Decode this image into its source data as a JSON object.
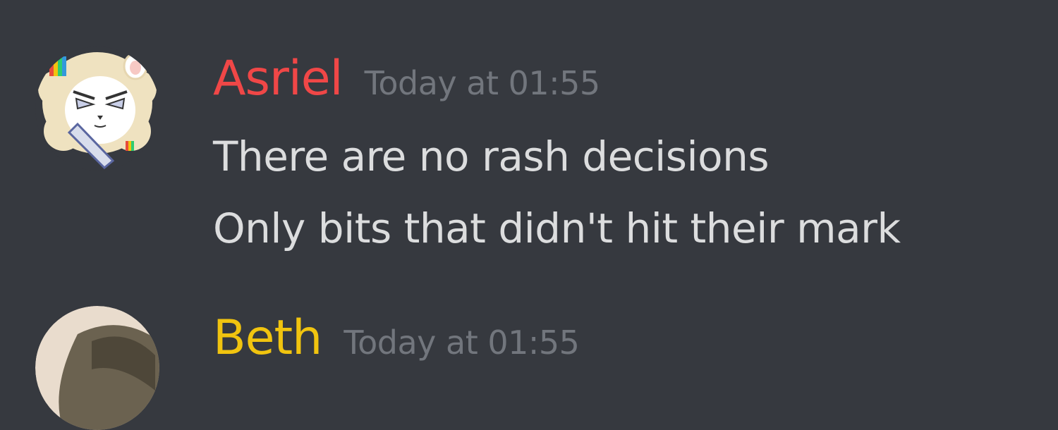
{
  "messages": [
    {
      "username": "Asriel",
      "username_color": "#f04747",
      "timestamp": "Today at 01:55",
      "lines": [
        "There are no rash decisions",
        "Only bits that didn't hit their mark"
      ],
      "avatar_icon": "goat-character-avatar"
    },
    {
      "username": "Beth",
      "username_color": "#f1c40f",
      "timestamp": "Today at 01:55",
      "lines": [],
      "avatar_icon": "photo-avatar"
    }
  ]
}
